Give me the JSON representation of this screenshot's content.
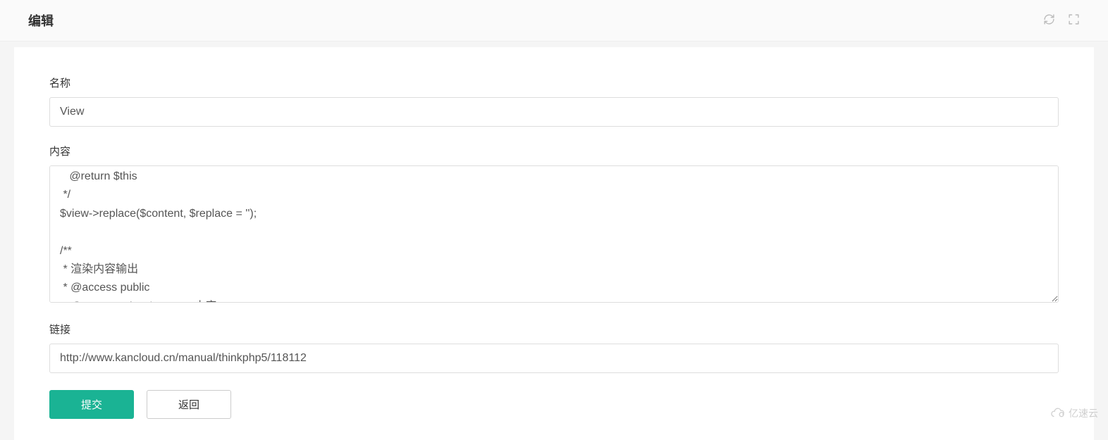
{
  "header": {
    "title": "编辑"
  },
  "form": {
    "name_label": "名称",
    "name_value": "View",
    "content_label": "内容",
    "content_value": "   @return $this\n */\n$view->replace($content, $replace = '');\n\n/**\n * 渲染内容输出\n * @access public\n * @param string $content 内容\n * @param array $vars    模板输出变量",
    "link_label": "链接",
    "link_value": "http://www.kancloud.cn/manual/thinkphp5/118112"
  },
  "buttons": {
    "submit": "提交",
    "back": "返回"
  },
  "watermark": {
    "text": "亿速云"
  }
}
